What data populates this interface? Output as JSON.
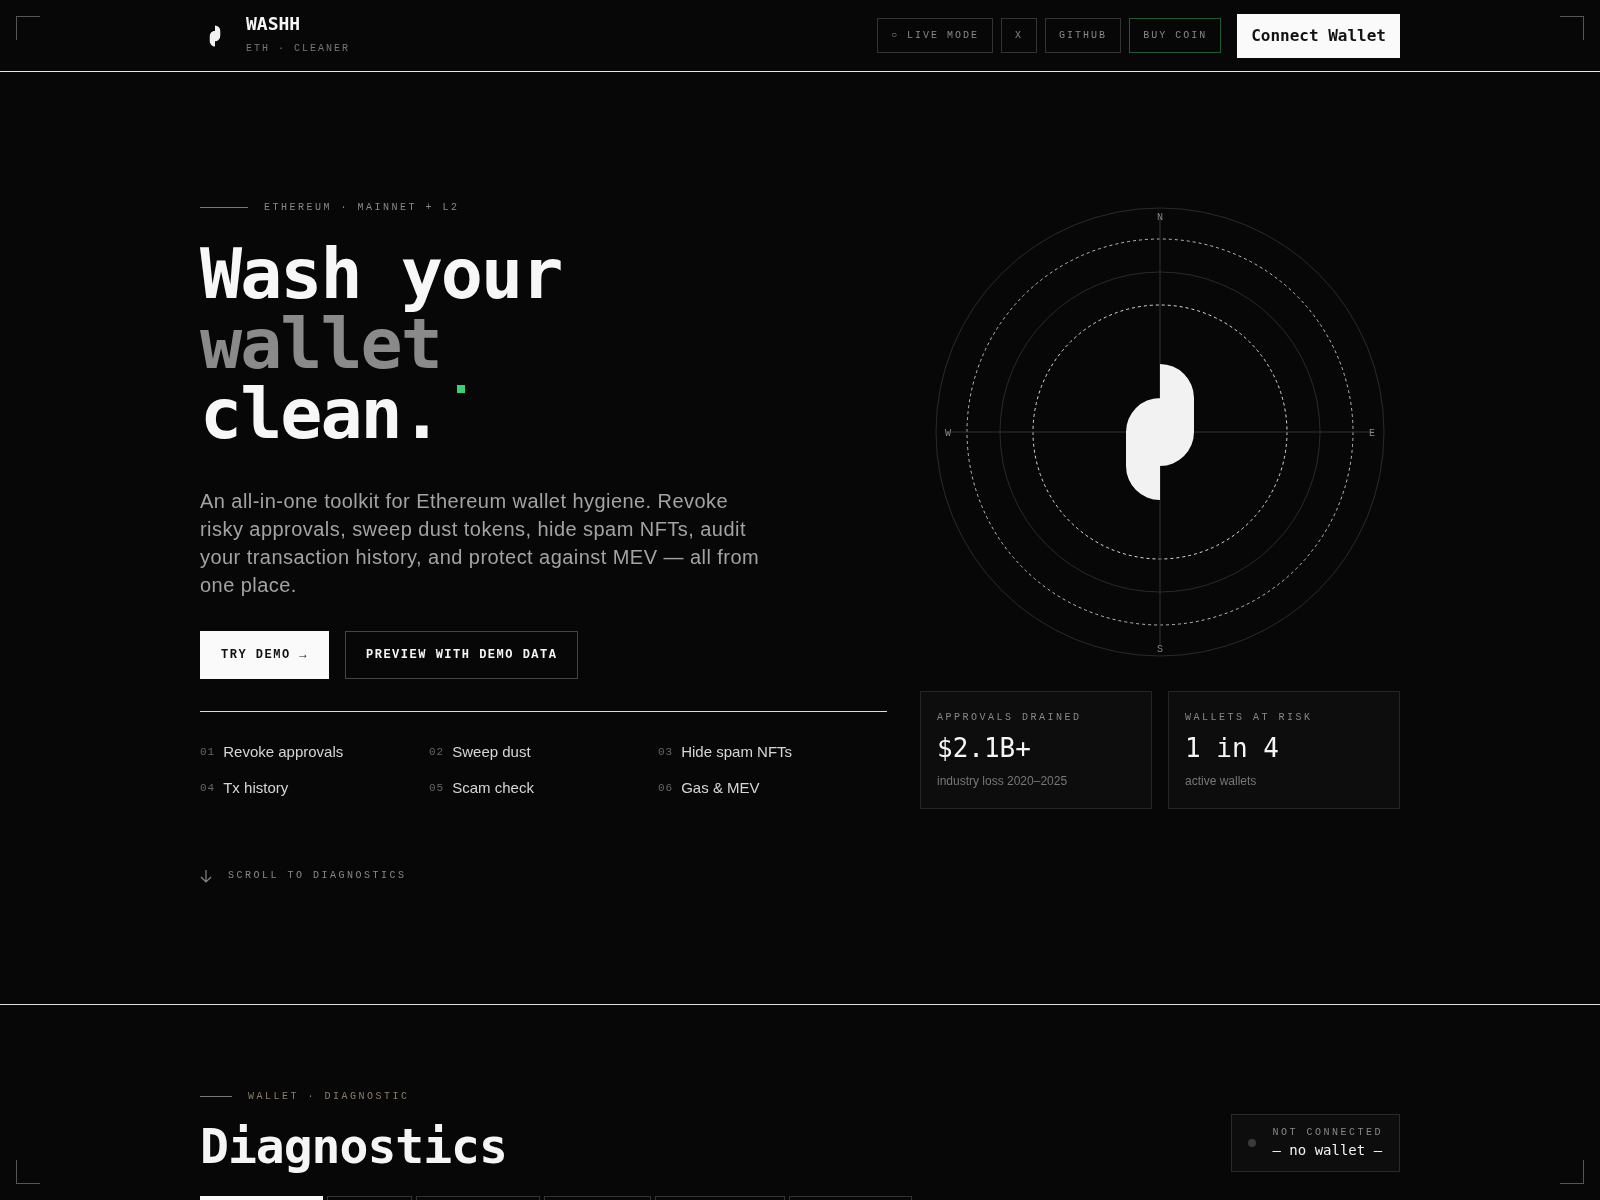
{
  "header": {
    "brand": "WASHH",
    "tagline": "ETH · CLEANER",
    "nav": [
      {
        "label": "○ LIVE MODE",
        "kind": "plain"
      },
      {
        "label": "X",
        "kind": "plain"
      },
      {
        "label": "GITHUB",
        "kind": "plain"
      },
      {
        "label": "BUY COIN",
        "kind": "accent"
      }
    ],
    "connect_button": "Connect Wallet"
  },
  "hero": {
    "eyebrow": "ETHEREUM · MAINNET + L2",
    "headline": [
      {
        "text": "Wash your",
        "muted": false
      },
      {
        "text": "wallet",
        "muted": true
      },
      {
        "text": "clean.",
        "muted": false
      }
    ],
    "paragraph": "An all-in-one toolkit for Ethereum wallet hygiene. Revoke risky approvals, sweep dust tokens, hide spam NFTs, audit your transaction history, and protect against MEV — all from one place.",
    "buttons": [
      {
        "label": "TRY DEMO →",
        "kind": "primary"
      },
      {
        "label": "PREVIEW WITH DEMO DATA",
        "kind": "outline"
      }
    ],
    "features": [
      {
        "number": "01",
        "label": "Revoke approvals"
      },
      {
        "number": "02",
        "label": "Sweep dust"
      },
      {
        "number": "03",
        "label": "Hide spam NFTs"
      },
      {
        "number": "04",
        "label": "Tx history"
      },
      {
        "number": "05",
        "label": "Scam check"
      },
      {
        "number": "06",
        "label": "Gas & MEV"
      }
    ],
    "scroll_hint": "SCROLL TO DIAGNOSTICS"
  },
  "compass": {
    "north": "N",
    "south": "S",
    "east": "E",
    "west": "W"
  },
  "stats": [
    {
      "label": "APPROVALS DRAINED",
      "value": "$2.1B+",
      "caption": "industry loss 2020–2025"
    },
    {
      "label": "WALLETS AT RISK",
      "value": "1 in 4",
      "caption": "active wallets"
    }
  ],
  "diagnostics": {
    "eyebrow": "WALLET · DIAGNOSTIC",
    "title": "Diagnostics",
    "status": {
      "label": "NOT CONNECTED",
      "value": "— no wallet —",
      "connected": false
    },
    "tabs": [
      {
        "selected": true
      },
      {
        "selected": false
      },
      {
        "selected": false
      },
      {
        "selected": false
      },
      {
        "selected": false
      },
      {
        "selected": false
      }
    ]
  }
}
